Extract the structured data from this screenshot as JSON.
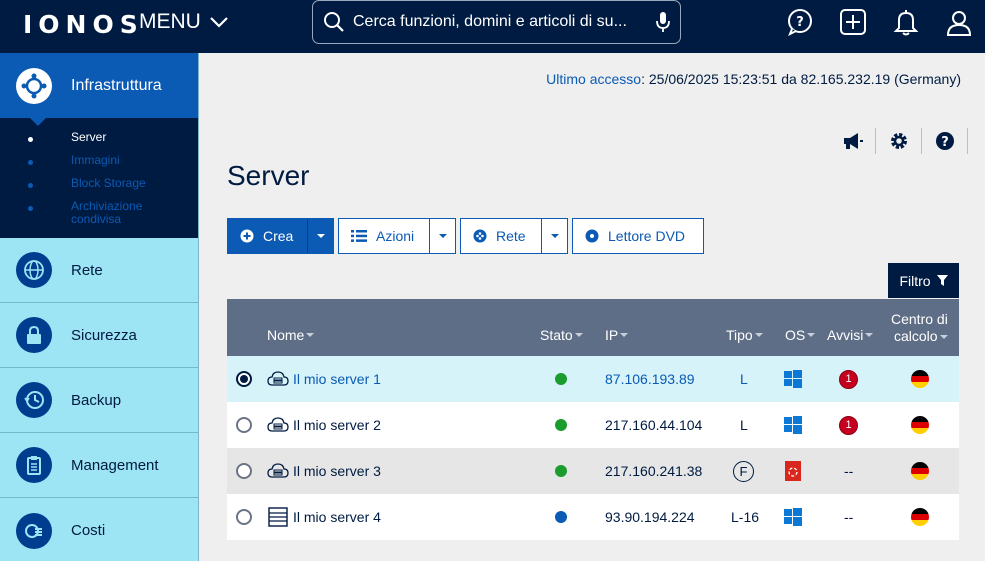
{
  "header": {
    "logo": "IONOS",
    "menu_label": "MENU",
    "search_placeholder": "Cerca funzioni, domini e articoli di su..."
  },
  "icons": {
    "help": "help-chat-icon",
    "add": "plus-square-icon",
    "notifications": "bell-icon",
    "user": "user-icon"
  },
  "sidebar": {
    "active_label": "Infrastruttura",
    "submenu": [
      {
        "label": "Server",
        "active": true
      },
      {
        "label": "Immagini",
        "active": false
      },
      {
        "label": "Block Storage",
        "active": false
      },
      {
        "label": "Archiviazione condivisa",
        "active": false
      }
    ],
    "items": [
      {
        "label": "Rete"
      },
      {
        "label": "Sicurezza"
      },
      {
        "label": "Backup"
      },
      {
        "label": "Management"
      },
      {
        "label": "Costi"
      }
    ]
  },
  "last_access": {
    "label": "Ultimo accesso",
    "value": ": 25/06/2025 15:23:51 da 82.165.232.19 (Germany)"
  },
  "page_title": "Server",
  "toolbar": {
    "create": "Crea",
    "actions": "Azioni",
    "network": "Rete",
    "dvd": "Lettore DVD",
    "filter": "Filtro"
  },
  "table": {
    "headers": {
      "name": "Nome",
      "status": "Stato",
      "ip": "IP",
      "type": "Tipo",
      "os": "OS",
      "alerts": "Avvisi",
      "datacenter_1": "Centro di",
      "datacenter_2": "calcolo"
    },
    "rows": [
      {
        "name": "Il mio server 1",
        "ip": "87.106.193.89",
        "type": "L",
        "alerts": "1",
        "status_color": "#1a9c2e",
        "selected": true
      },
      {
        "name": "Il mio server 2",
        "ip": "217.160.44.104",
        "type": "L",
        "alerts": "1",
        "status_color": "#1a9c2e",
        "selected": false
      },
      {
        "name": "Il mio server 3",
        "ip": "217.160.241.38",
        "type": "F",
        "alerts": "--",
        "status_color": "#1a9c2e",
        "selected": false
      },
      {
        "name": "Il mio server 4",
        "ip": "93.90.194.224",
        "type": "L-16",
        "alerts": "--",
        "status_color": "#0b5ab4",
        "selected": false
      }
    ]
  },
  "colors": {
    "navy": "#001b41",
    "blue": "#0b5ab4",
    "sidebar": "#9de4f4",
    "running": "#1a9c2e",
    "alert": "#c5001e"
  }
}
